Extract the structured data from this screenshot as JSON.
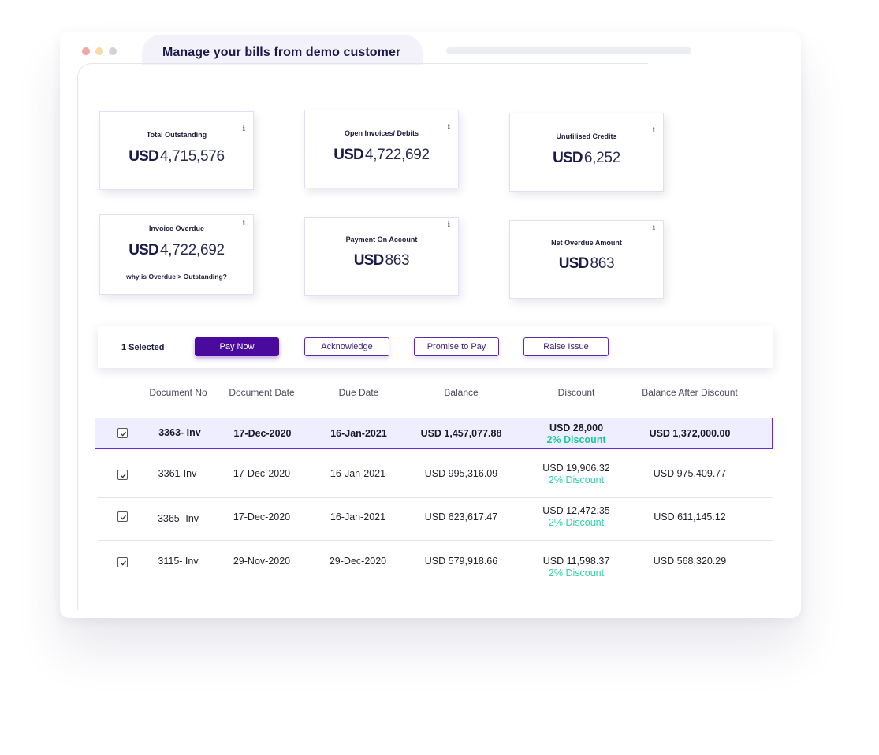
{
  "window": {
    "title": "Manage your bills from demo customer"
  },
  "cards": [
    {
      "title": "Total Outstanding",
      "currency": "USD",
      "amount": "4,715,576",
      "note": ""
    },
    {
      "title": "Open Invoices/ Debits",
      "currency": "USD",
      "amount": "4,722,692",
      "note": ""
    },
    {
      "title": "Unutilised Credits",
      "currency": "USD",
      "amount": "6,252",
      "note": ""
    },
    {
      "title": "Invoice Overdue",
      "currency": "USD",
      "amount": "4,722,692",
      "note": "why is Overdue > Outstanding?"
    },
    {
      "title": "Payment On Account",
      "currency": "USD",
      "amount": "863",
      "note": ""
    },
    {
      "title": "Net Overdue Amount",
      "currency": "USD",
      "amount": "863",
      "note": ""
    }
  ],
  "info_glyph": "i",
  "actions": {
    "selected_count": "1 Selected",
    "pay_now": "Pay Now",
    "acknowledge": "Acknowledge",
    "promise_to_pay": "Promise to Pay",
    "raise_issue": "Raise Issue"
  },
  "table": {
    "columns": [
      "Document No",
      "Document Date",
      "Due Date",
      "Balance",
      "Discount",
      "Balance After Discount"
    ],
    "rows": [
      {
        "checked": true,
        "highlighted": true,
        "doc_no": "3363- Inv",
        "doc_date": "17-Dec-2020",
        "due_date": "16-Jan-2021",
        "balance": "USD 1,457,077.88",
        "discount": "USD 28,000",
        "discount_pct": "2% Discount",
        "balance_after": "USD 1,372,000.00"
      },
      {
        "checked": true,
        "highlighted": false,
        "doc_no": "3361-Inv",
        "doc_date": "17-Dec-2020",
        "due_date": "16-Jan-2021",
        "balance": "USD 995,316.09",
        "discount": "USD 19,906.32",
        "discount_pct": "2% Discount",
        "balance_after": "USD 975,409.77"
      },
      {
        "checked": true,
        "highlighted": false,
        "doc_no": "3365- Inv",
        "doc_date": "17-Dec-2020",
        "due_date": "16-Jan-2021",
        "balance": "USD 623,617.47",
        "discount": "USD 12,472.35",
        "discount_pct": "2% Discount",
        "balance_after": "USD 611,145.12"
      },
      {
        "checked": true,
        "highlighted": false,
        "doc_no": "3115- Inv",
        "doc_date": "29-Nov-2020",
        "due_date": "29-Dec-2020",
        "balance": "USD 579,918.66",
        "discount": "USD 11,598.37",
        "discount_pct": "2% Discount",
        "balance_after": "USD 568,320.29"
      }
    ]
  },
  "colors": {
    "brand": "#4a0a9e",
    "discount_green": "#2dd4a8",
    "highlight_bg": "#efeefe",
    "highlight_border": "#6a2bd6"
  }
}
